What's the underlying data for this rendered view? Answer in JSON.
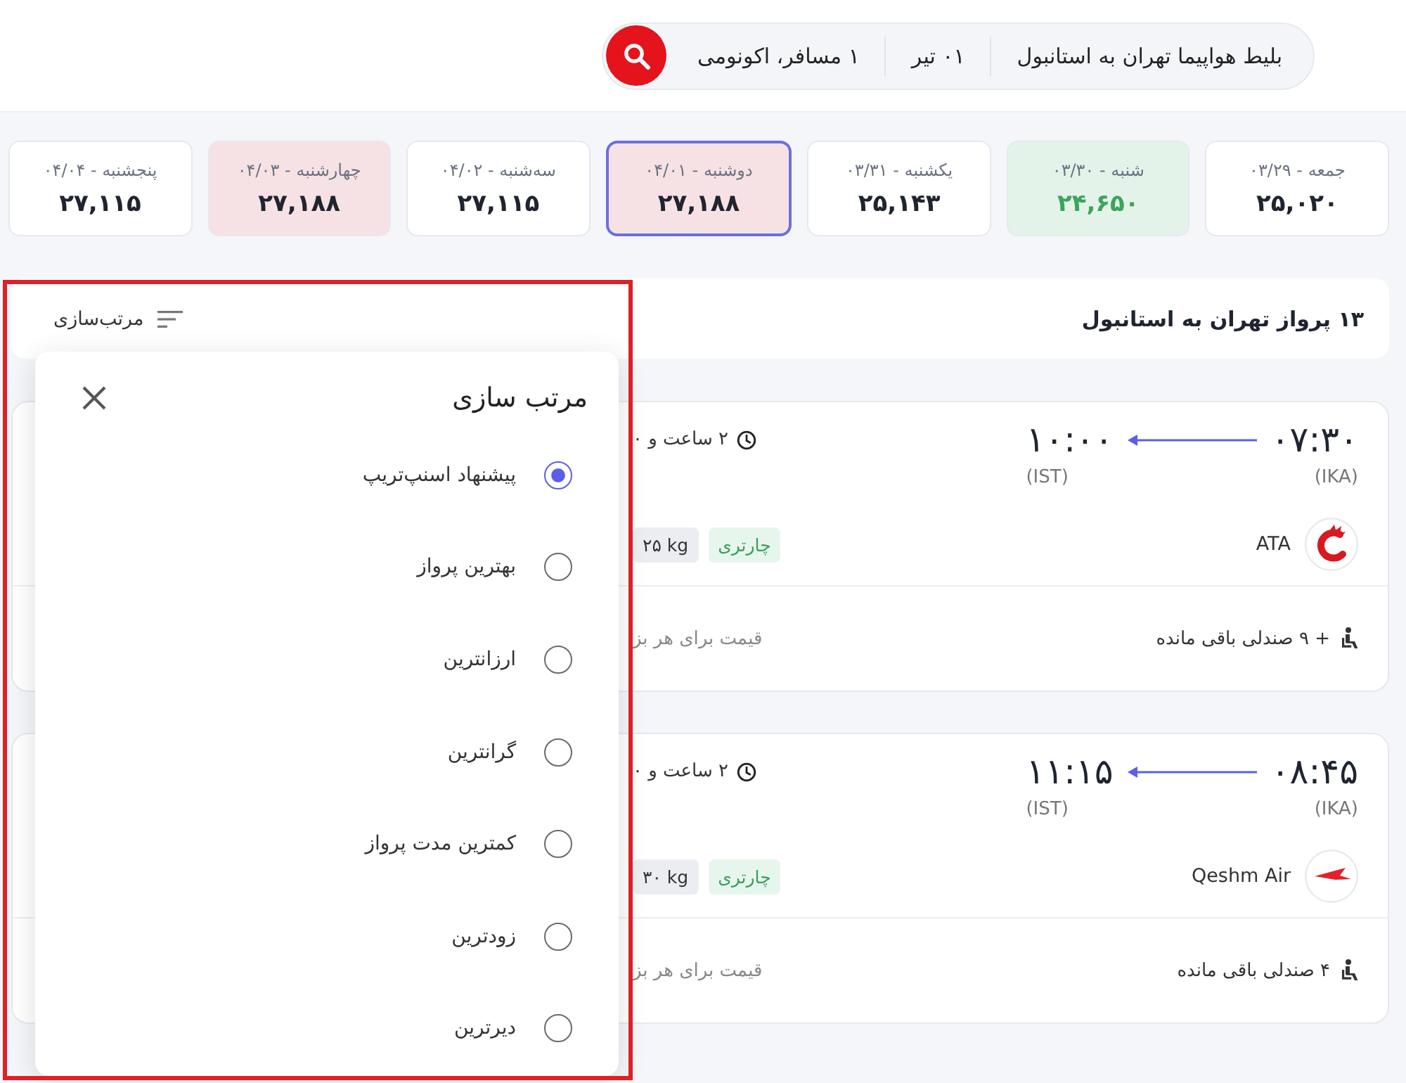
{
  "search_bar": {
    "route": "بلیط هواپیما تهران به استانبول",
    "date": "۰۱ تیر",
    "passengers": "۱ مسافر، اکونومی"
  },
  "date_strip": [
    {
      "day": "جمعه - ۰۳/۲۹",
      "price": {
        "text": "۲۵,۰۲۰",
        "color": "#1f2430"
      },
      "color": "#ffffff",
      "selected": false
    },
    {
      "day": "شنبه - ۰۳/۳۰",
      "price": {
        "text": "۲۴,۶۵۰",
        "color": "#3ca55c"
      },
      "color": "#e4f3ea",
      "selected": false
    },
    {
      "day": "یکشنبه - ۰۳/۳۱",
      "price": {
        "text": "۲۵,۱۴۳",
        "color": "#1f2430"
      },
      "color": "#ffffff",
      "selected": false
    },
    {
      "day": "دوشنبه - ۰۴/۰۱",
      "price": {
        "text": "۲۷,۱۸۸",
        "color": "#1f2430"
      },
      "color": "#f6e2e4",
      "selected": true
    },
    {
      "day": "سه‌شنبه - ۰۴/۰۲",
      "price": {
        "text": "۲۷,۱۱۵",
        "color": "#1f2430"
      },
      "color": "#ffffff",
      "selected": false
    },
    {
      "day": "چهارشنبه - ۰۴/۰۳",
      "price": {
        "text": "۲۷,۱۸۸",
        "color": "#1f2430"
      },
      "color": "#f6e2e4",
      "selected": false
    },
    {
      "day": "پنجشنبه - ۰۴/۰۴",
      "price": {
        "text": "۲۷,۱۱۵",
        "color": "#1f2430"
      },
      "color": "#ffffff",
      "selected": false
    }
  ],
  "results": {
    "title": "۱۳ پرواز تهران به استانبول",
    "sort_label": "مرتب‌سازی"
  },
  "flights": [
    {
      "departure": {
        "time": "۰۷:۳۰",
        "airport": "(IKA)"
      },
      "arrival": {
        "time": "۱۰:۰۰",
        "airport": "(IST)"
      },
      "duration": "۲ ساعت و ۰",
      "airline": "ATA",
      "tags": [
        {
          "kind": "charter",
          "text": "چارتری"
        },
        {
          "kind": "baggage",
          "text": "۲۵ kg"
        }
      ],
      "seats": "+ ۹ صندلی باقی مانده",
      "price_note": "قیمت برای هر بز"
    },
    {
      "departure": {
        "time": "۰۸:۴۵",
        "airport": "(IKA)"
      },
      "arrival": {
        "time": "۱۱:۱۵",
        "airport": "(IST)"
      },
      "duration": "۲ ساعت و ۰",
      "airline": "Qeshm Air",
      "tags": [
        {
          "kind": "charter",
          "text": "چارتری"
        },
        {
          "kind": "baggage",
          "text": "۳۰ kg"
        }
      ],
      "seats": "۴ صندلی باقی مانده",
      "price_note": "قیمت برای هر بز"
    }
  ],
  "sort_panel": {
    "title": "مرتب سازی",
    "options": [
      {
        "label": "پیشنهاد اسنپ‌تریپ",
        "selected": true
      },
      {
        "label": "بهترین پرواز",
        "selected": false
      },
      {
        "label": "ارزانترین",
        "selected": false
      },
      {
        "label": "گرانترین",
        "selected": false
      },
      {
        "label": "کمترین مدت پرواز",
        "selected": false
      },
      {
        "label": "زودترین",
        "selected": false
      },
      {
        "label": "دیرترین",
        "selected": false
      }
    ]
  }
}
